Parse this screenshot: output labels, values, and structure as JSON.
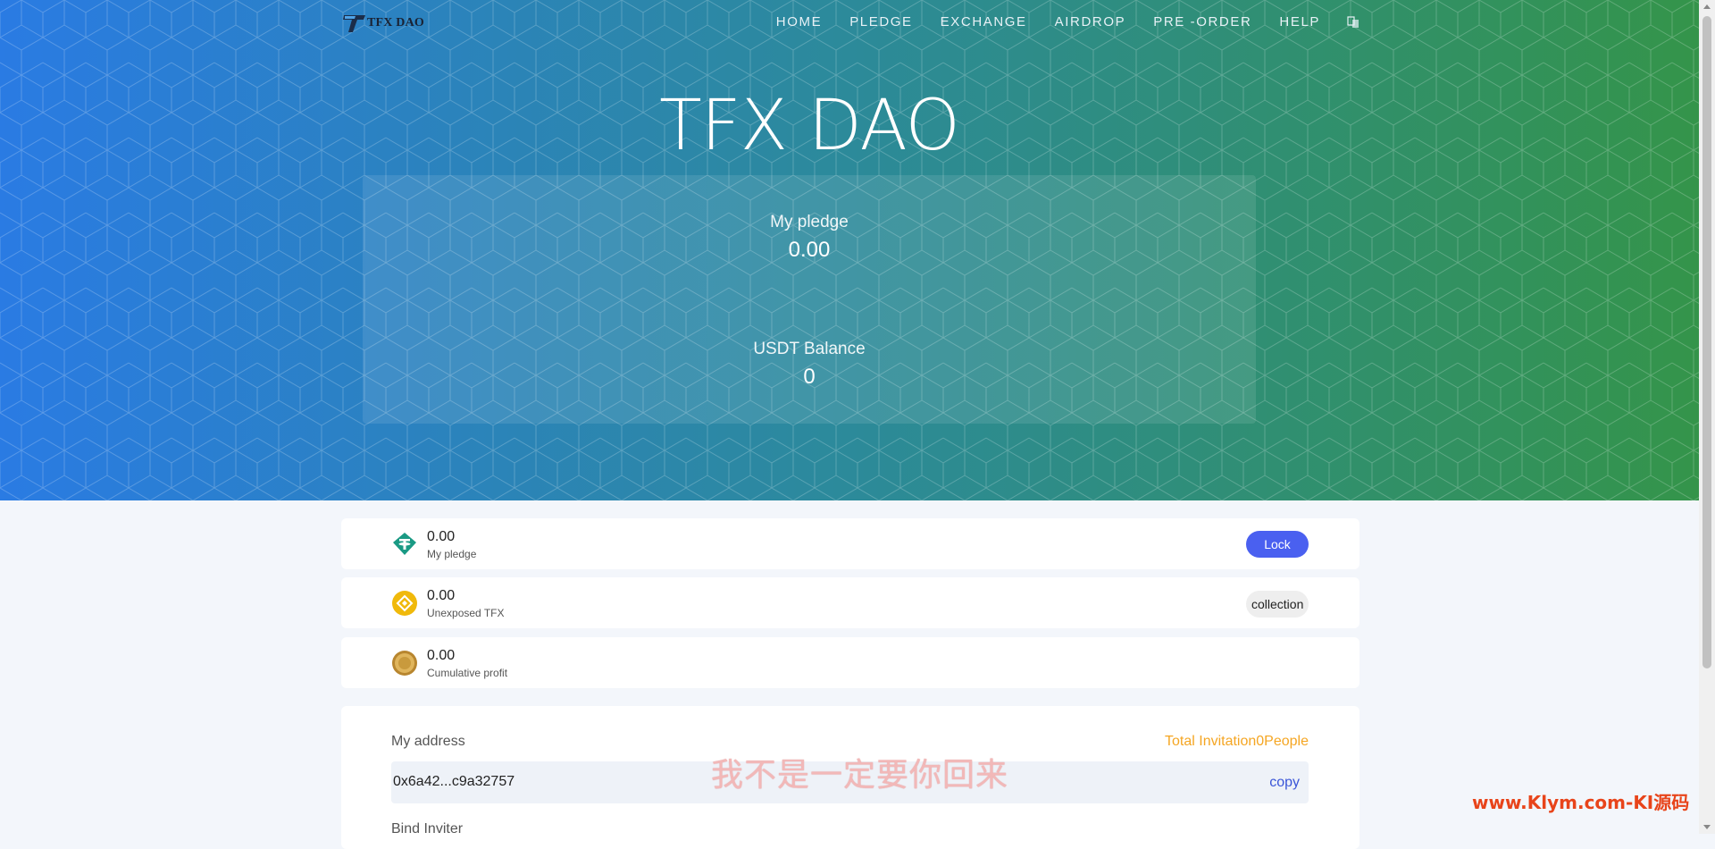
{
  "nav": {
    "logo_text": "TFX DAO",
    "items": [
      {
        "label": "HOME"
      },
      {
        "label": "PLEDGE"
      },
      {
        "label": "EXCHANGE"
      },
      {
        "label": "AIRDROP"
      },
      {
        "label": "PRE -ORDER"
      },
      {
        "label": "HELP"
      }
    ],
    "language_icon": "translate-icon"
  },
  "hero": {
    "title": "TFX DAO",
    "stats": [
      {
        "label": "My pledge",
        "value": "0.00"
      },
      {
        "label": "USDT Balance",
        "value": "0"
      }
    ]
  },
  "assets": [
    {
      "value": "0.00",
      "label": "My pledge",
      "icon": "usdt-icon",
      "action": "Lock"
    },
    {
      "value": "0.00",
      "label": "Unexposed TFX",
      "icon": "bnb-coin-icon",
      "action": "collection"
    },
    {
      "value": "0.00",
      "label": "Cumulative profit",
      "icon": "gold-coin-icon"
    }
  ],
  "address": {
    "title": "My address",
    "invitation_text": "Total Invitation0People",
    "address": "0x6a42...c9a32757",
    "copy_label": "copy",
    "bind_title": "Bind Inviter"
  },
  "overlay": {
    "caption": "我不是一定要你回来",
    "watermark": "www.Klym.com-KI源码"
  },
  "colors": {
    "gradient_start": "#2a7be3",
    "gradient_end": "#34944a",
    "lock_button": "#4a60f0",
    "invitation": "#f5a623",
    "copy_link": "#3a55d8"
  }
}
